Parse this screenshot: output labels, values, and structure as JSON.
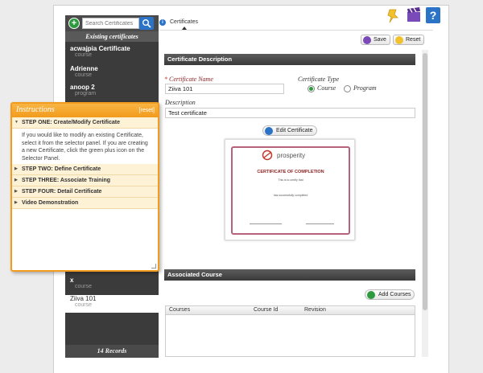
{
  "selector": {
    "search_placeholder": "Search Certificates",
    "header": "Existing certificates",
    "items": [
      {
        "title": "acwajpia Certificate",
        "type": "course"
      },
      {
        "title": "Adrienne",
        "type": "course"
      },
      {
        "title": "anoop 2",
        "type": "program"
      },
      {
        "title": "x",
        "type": "course"
      },
      {
        "title": "Ziiva 101",
        "type": "course"
      }
    ],
    "footer": "14 Records"
  },
  "tab": {
    "label": "Certificates"
  },
  "toolbar": {
    "save_label": "Save",
    "reset_label": "Reset"
  },
  "certificate_description": {
    "section_title": "Certificate Description",
    "name_label": "Certificate Name",
    "name_required_mark": "*",
    "name_value": "Ziiva 101",
    "type_label": "Certificate Type",
    "type_options": [
      "Course",
      "Program"
    ],
    "type_selected": "Course",
    "description_label": "Description",
    "description_value": "Test certificate",
    "edit_button": "Edit Certificate"
  },
  "certificate_preview": {
    "brand": "prosperity",
    "title": "CERTIFICATE OF COMPLETION",
    "certify_text": "This is to certify that",
    "completed_text": "has successfully completed"
  },
  "associated_course": {
    "section_title": "Associated Course",
    "add_button": "Add Courses",
    "columns": [
      "Courses",
      "Course Id",
      "Revision"
    ]
  },
  "instructions": {
    "title": "Instructions",
    "reset": "[reset]",
    "steps": [
      {
        "label": "STEP ONE: Create/Modify Certificate",
        "open": true,
        "body": "If you would like to modify an existing Certificate, select it from the selector panel. If you are creating a new Certificate, click the green plus icon on the Selector Panel."
      },
      {
        "label": "STEP TWO: Define Certificate"
      },
      {
        "label": "STEP THREE: Associate Training"
      },
      {
        "label": "STEP FOUR: Detail Certificate"
      },
      {
        "label": "Video Demonstration"
      }
    ]
  },
  "colors": {
    "accent": "#f29b1c",
    "panel": "#3b3b3b",
    "primary_blue": "#2a73c7",
    "green": "#2e9a3e"
  }
}
